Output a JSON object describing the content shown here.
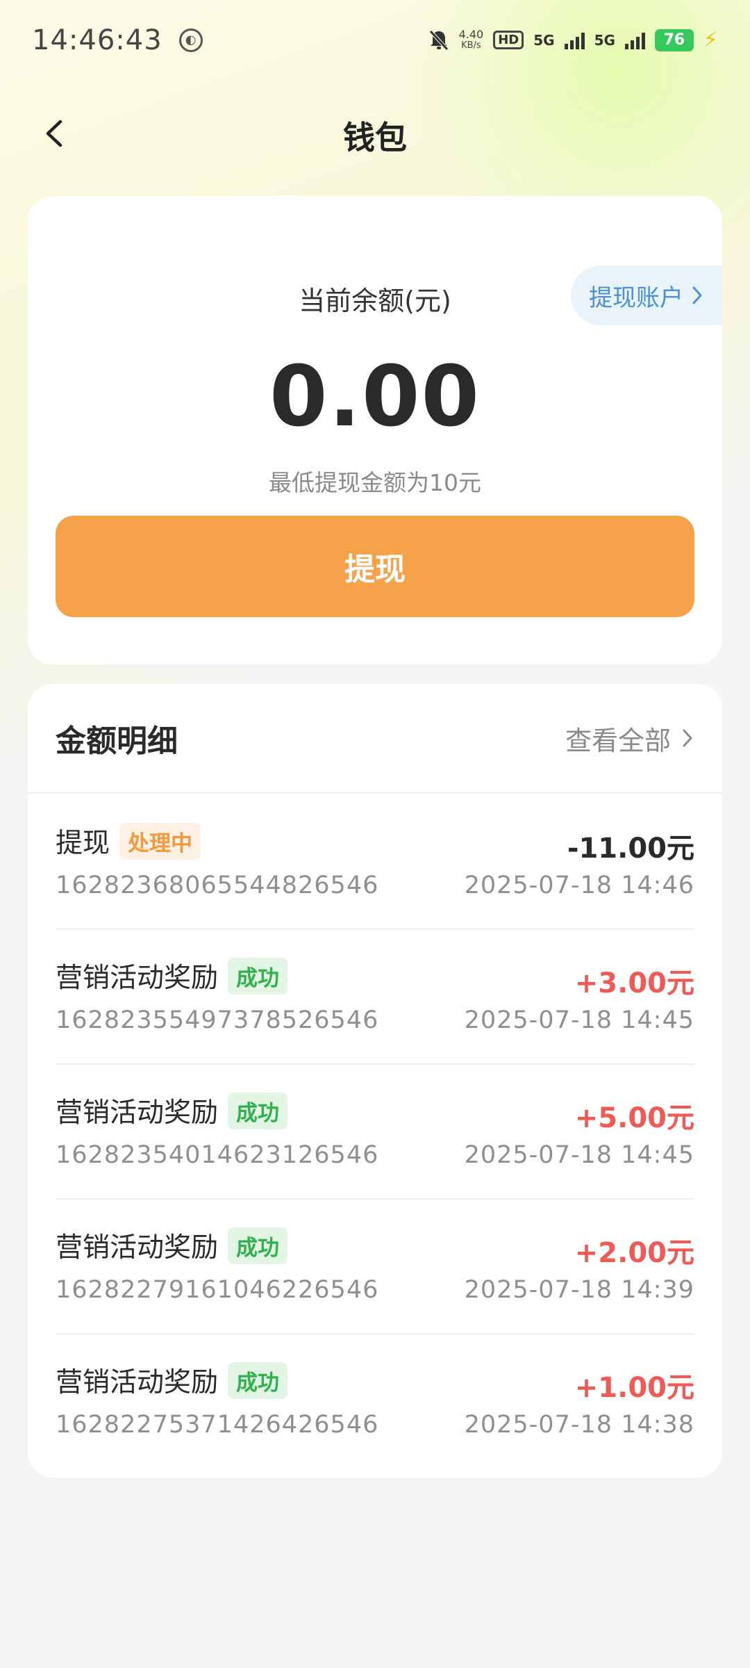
{
  "status_bar": {
    "time": "14:46:43",
    "speed_value": "4.40",
    "speed_unit": "KB/s",
    "hd_label": "HD",
    "net_1": "5G",
    "net_2": "5G",
    "battery": "76"
  },
  "header": {
    "title": "钱包"
  },
  "balance": {
    "label": "当前余额(元)",
    "amount": "0.00",
    "min_hint": "最低提现金额为10元",
    "withdraw_account_label": "提现账户",
    "withdraw_button_label": "提现"
  },
  "details": {
    "title": "金额明细",
    "view_all_label": "查看全部",
    "items": [
      {
        "name": "提现",
        "status": "处理中",
        "status_type": "processing",
        "id": "1628236806554482654б",
        "amount": "-11.00元",
        "amount_type": "neg",
        "time": "2025-07-18 14:46"
      },
      {
        "name": "营销活动奖励",
        "status": "成功",
        "status_type": "success",
        "id": "1628235549737852654б",
        "amount": "+3.00元",
        "amount_type": "pos",
        "time": "2025-07-18 14:45"
      },
      {
        "name": "营销活动奖励",
        "status": "成功",
        "status_type": "success",
        "id": "1628235401462312654б",
        "amount": "+5.00元",
        "amount_type": "pos",
        "time": "2025-07-18 14:45"
      },
      {
        "name": "营销活动奖励",
        "status": "成功",
        "status_type": "success",
        "id": "1628227916104622654б",
        "amount": "+2.00元",
        "amount_type": "pos",
        "time": "2025-07-18 14:39"
      },
      {
        "name": "营销活动奖励",
        "status": "成功",
        "status_type": "success",
        "id": "1628227537142642654б",
        "amount": "+1.00元",
        "amount_type": "pos",
        "time": "2025-07-18 14:38"
      }
    ]
  },
  "colors": {
    "accent": "#f5a24a",
    "link": "#4c8fd6",
    "positive": "#ee5b57",
    "success": "#2fb24c",
    "processing": "#f29a3c"
  },
  "icons": {
    "back": "chevron-left-icon",
    "chevron": "chevron-right-icon",
    "battery": "battery-icon",
    "charging": "bolt-icon",
    "silent": "bell-off-icon"
  }
}
